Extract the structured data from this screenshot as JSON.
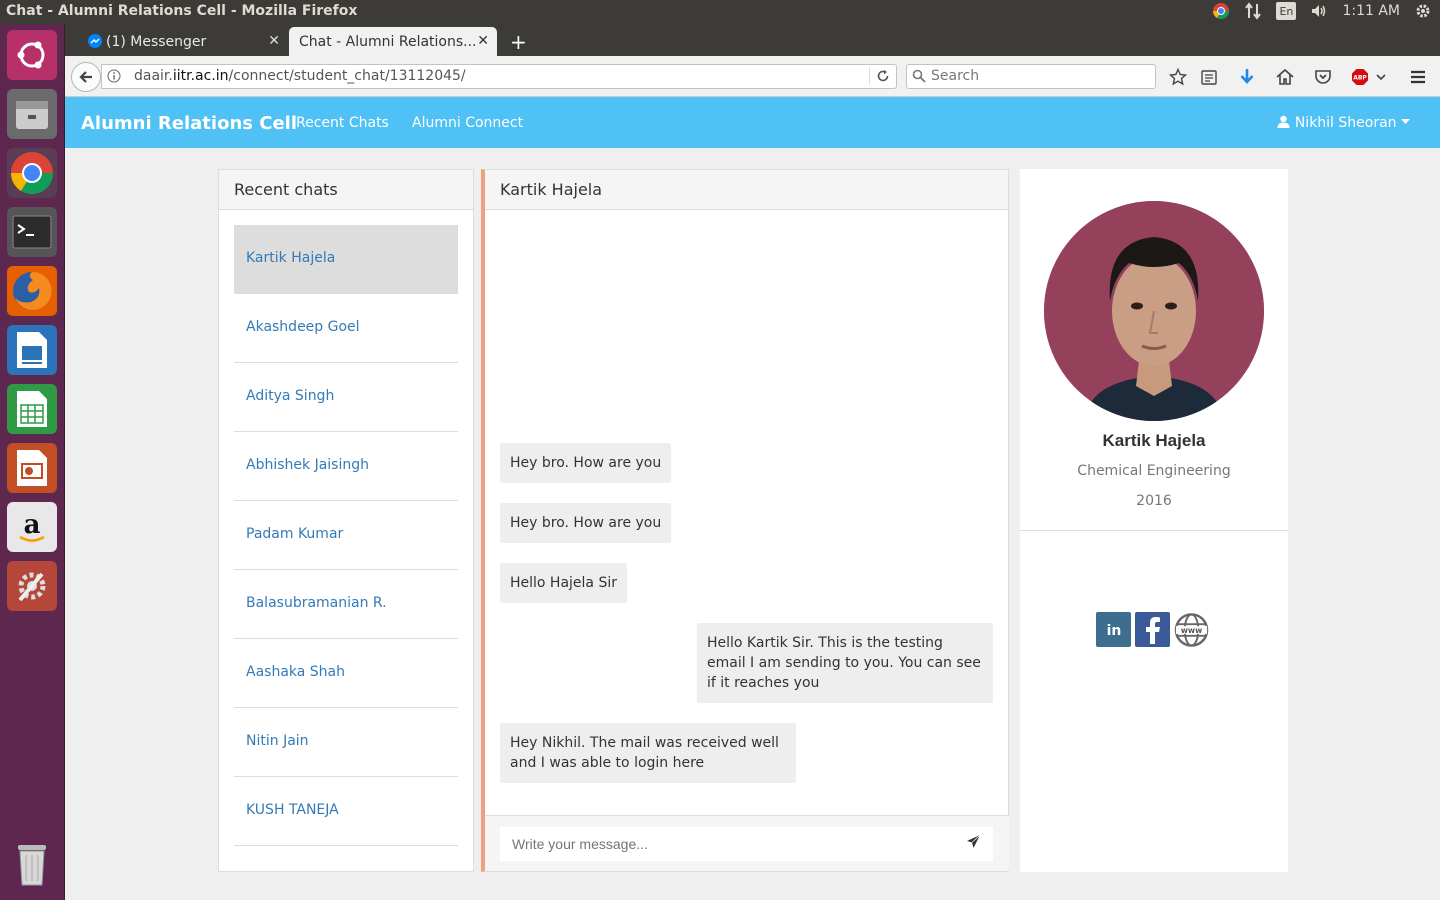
{
  "os": {
    "window_title": "Chat - Alumni Relations Cell - Mozilla Firefox",
    "clock": "1:11 AM",
    "keyboard_layout": "En"
  },
  "launcher": {
    "items": [
      "ubuntu-dash",
      "files",
      "chrome",
      "terminal",
      "firefox",
      "writer",
      "calc",
      "impress",
      "amazon",
      "system-settings",
      "trash"
    ]
  },
  "browser": {
    "tabs": [
      {
        "label": "(1) Messenger"
      },
      {
        "label": "Chat - Alumni Relations..."
      }
    ],
    "url_prefix": "daair.",
    "url_host": "iitr.ac.in",
    "url_path": "/connect/student_chat/13112045/",
    "search_placeholder": "Search"
  },
  "app": {
    "brand": "Alumni Relations Cell",
    "nav": [
      "Recent Chats",
      "Alumni Connect"
    ],
    "user": "Nikhil Sheoran"
  },
  "recent": {
    "heading": "Recent chats",
    "items": [
      "Kartik Hajela",
      "Akashdeep Goel",
      "Aditya Singh",
      "Abhishek Jaisingh",
      "Padam Kumar",
      "Balasubramanian R.",
      "Aashaka Shah",
      "Nitin Jain",
      "KUSH TANEJA"
    ]
  },
  "chat": {
    "heading": "Kartik Hajela",
    "messages": [
      {
        "side": "left",
        "text": "Hey bro. How are you"
      },
      {
        "side": "left",
        "text": "Hey bro. How are you"
      },
      {
        "side": "left",
        "text": "Hello Hajela Sir"
      },
      {
        "side": "right",
        "text": "Hello Kartik Sir. This is the testing email I am sending to you. You can see if it reaches you"
      },
      {
        "side": "left",
        "text": "Hey Nikhil. The mail was received well and I was able to login here"
      }
    ],
    "input_placeholder": "Write your message..."
  },
  "profile": {
    "name": "Kartik Hajela",
    "department": "Chemical Engineering",
    "year": "2016",
    "social": [
      "linkedin-icon",
      "facebook-icon",
      "website-icon"
    ]
  },
  "colors": {
    "navbar": "#4fc1f5",
    "launcher": "#5e2750",
    "link": "#337ab7",
    "chat_accent": "#f0a07e"
  }
}
